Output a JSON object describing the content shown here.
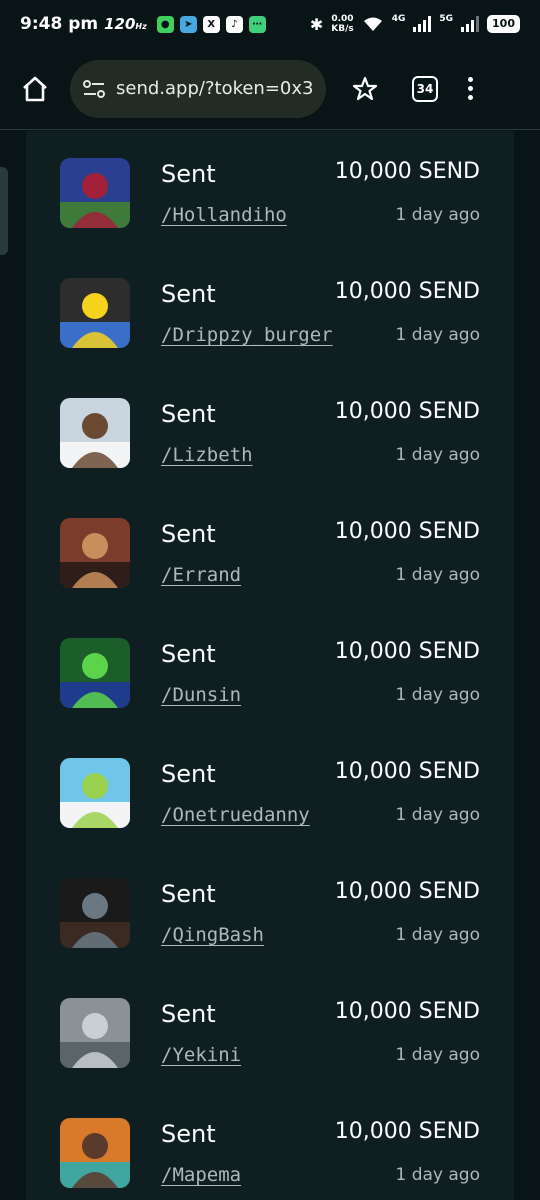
{
  "status_bar": {
    "time": "9:48 pm",
    "refresh_rate": "120",
    "net_speed_value": "0.00",
    "net_speed_unit": "KB/s",
    "network_4g": "4G",
    "network_5g": "5G",
    "battery": "100"
  },
  "browser": {
    "url": "send.app/?token=0x3",
    "tab_count": "34"
  },
  "activity": [
    {
      "type": "Sent",
      "amount": "10,000 SEND",
      "user": "/Hollandiho",
      "time": "1 day ago",
      "avatar_colors": [
        "#2a3f8f",
        "#a22038",
        "#3e7a3a"
      ]
    },
    {
      "type": "Sent",
      "amount": "10,000 SEND",
      "user": "/Drippzy_burger",
      "time": "1 day ago",
      "avatar_colors": [
        "#2d2d2d",
        "#f5d21c",
        "#3a6fc9"
      ]
    },
    {
      "type": "Sent",
      "amount": "10,000 SEND",
      "user": "/Lizbeth",
      "time": "1 day ago",
      "avatar_colors": [
        "#c9d6e0",
        "#6b4a34",
        "#f2f4f6"
      ]
    },
    {
      "type": "Sent",
      "amount": "10,000 SEND",
      "user": "/Errand",
      "time": "1 day ago",
      "avatar_colors": [
        "#7d3b2c",
        "#c98e5c",
        "#2e1d18"
      ]
    },
    {
      "type": "Sent",
      "amount": "10,000 SEND",
      "user": "/Dunsin",
      "time": "1 day ago",
      "avatar_colors": [
        "#1b5e2a",
        "#5bd34a",
        "#1e3b8c"
      ]
    },
    {
      "type": "Sent",
      "amount": "10,000 SEND",
      "user": "/Onetruedanny",
      "time": "1 day ago",
      "avatar_colors": [
        "#6fc6e8",
        "#9ad14f",
        "#f4f4f4"
      ]
    },
    {
      "type": "Sent",
      "amount": "10,000 SEND",
      "user": "/QingBash",
      "time": "1 day ago",
      "avatar_colors": [
        "#1a1a1a",
        "#6a7883",
        "#3b2a22"
      ]
    },
    {
      "type": "Sent",
      "amount": "10,000 SEND",
      "user": "/Yekini",
      "time": "1 day ago",
      "avatar_colors": [
        "#8a9296",
        "#c9cfd2",
        "#5b6468"
      ]
    },
    {
      "type": "Sent",
      "amount": "10,000 SEND",
      "user": "/Mapema",
      "time": "1 day ago",
      "avatar_colors": [
        "#d9792a",
        "#5a3a2a",
        "#3fa6a0"
      ]
    }
  ]
}
